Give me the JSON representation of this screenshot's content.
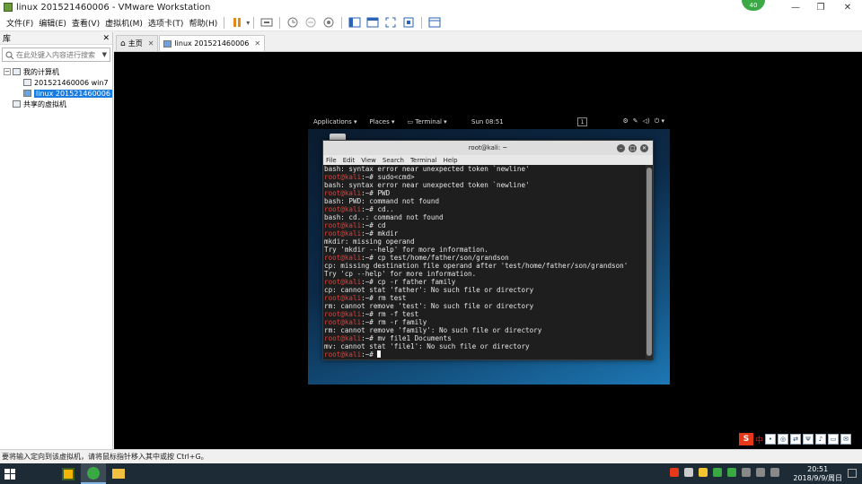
{
  "window": {
    "title": "linux 201521460006 - VMware Workstation",
    "badge": "40"
  },
  "menu": [
    "文件(F)",
    "编辑(E)",
    "查看(V)",
    "虚拟机(M)",
    "选项卡(T)",
    "帮助(H)"
  ],
  "sidebar": {
    "header": "库",
    "search_placeholder": "在此处键入内容进行搜索",
    "tree": {
      "root": "我的计算机",
      "items": [
        "201521460006 win7",
        "linux 201521460006"
      ],
      "shared": "共享的虚拟机"
    }
  },
  "tabs": [
    {
      "label": "主页"
    },
    {
      "label": "linux 201521460006"
    }
  ],
  "kali": {
    "panel": {
      "applications": "Applications ▾",
      "places": "Places ▾",
      "terminal": "Terminal ▾",
      "clock": "Sun 08:51",
      "workspace": "1"
    },
    "terminal": {
      "title": "root@kali: ~",
      "menu": [
        "File",
        "Edit",
        "View",
        "Search",
        "Terminal",
        "Help"
      ],
      "prompt": "root@kali",
      "lines": [
        {
          "t": "out",
          "text": "bash: syntax error near unexpected token `newline'"
        },
        {
          "t": "cmd",
          "text": "sudo<cmd>"
        },
        {
          "t": "out",
          "text": "bash: syntax error near unexpected token `newline'"
        },
        {
          "t": "cmd",
          "text": "PWD"
        },
        {
          "t": "out",
          "text": "bash: PWD: command not found"
        },
        {
          "t": "cmd",
          "text": "cd.."
        },
        {
          "t": "out",
          "text": "bash: cd..: command not found"
        },
        {
          "t": "cmd",
          "text": "cd"
        },
        {
          "t": "cmd",
          "text": "mkdir"
        },
        {
          "t": "out",
          "text": "mkdir: missing operand"
        },
        {
          "t": "out",
          "text": "Try 'mkdir --help' for more information."
        },
        {
          "t": "cmd",
          "text": "cp test/home/father/son/grandson"
        },
        {
          "t": "out",
          "text": "cp: missing destination file operand after 'test/home/father/son/grandson'"
        },
        {
          "t": "out",
          "text": "Try 'cp --help' for more information."
        },
        {
          "t": "cmd",
          "text": "cp -r father family"
        },
        {
          "t": "out",
          "text": "cp: cannot stat 'father': No such file or directory"
        },
        {
          "t": "cmd",
          "text": "rm test"
        },
        {
          "t": "out",
          "text": "rm: cannot remove 'test': No such file or directory"
        },
        {
          "t": "cmd",
          "text": "rm -f test"
        },
        {
          "t": "cmd",
          "text": "rm -r family"
        },
        {
          "t": "out",
          "text": "rm: cannot remove 'family': No such file or directory"
        },
        {
          "t": "cmd",
          "text": "mv file1 Documents"
        },
        {
          "t": "out",
          "text": "mv: cannot stat 'file1': No such file or directory"
        },
        {
          "t": "cur",
          "text": ""
        }
      ]
    }
  },
  "status": {
    "text": "要将输入定向到该虚拟机，请将鼠标指针移入其中或按 Ctrl+G。",
    "ime": "中"
  },
  "taskbar": {
    "time": "20:51",
    "date": "2018/9/9/周日"
  },
  "colors": {
    "accent": "#1a7be0",
    "prompt": "#e0403a",
    "taskbar": "#1c2b36"
  }
}
